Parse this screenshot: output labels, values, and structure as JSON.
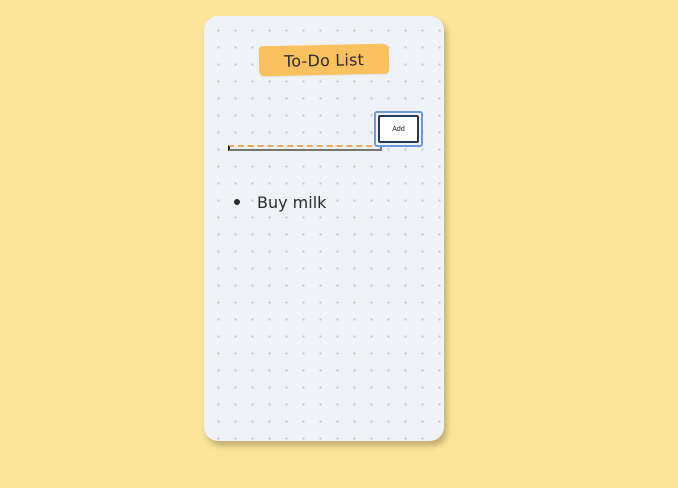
{
  "app": {
    "title": "To-Do List"
  },
  "form": {
    "input_value": "",
    "input_placeholder": "",
    "add_label": "Add"
  },
  "todos": [
    {
      "text": "Buy milk"
    }
  ],
  "colors": {
    "background": "#fce49a",
    "card": "#eff3f8",
    "title_tag": "#fbc15e",
    "input_underline": "#e8a95a",
    "button_focus_ring": "#6c9ad6",
    "button_border": "#27395a"
  },
  "icons": {
    "list_bullet": "bullet-icon"
  }
}
